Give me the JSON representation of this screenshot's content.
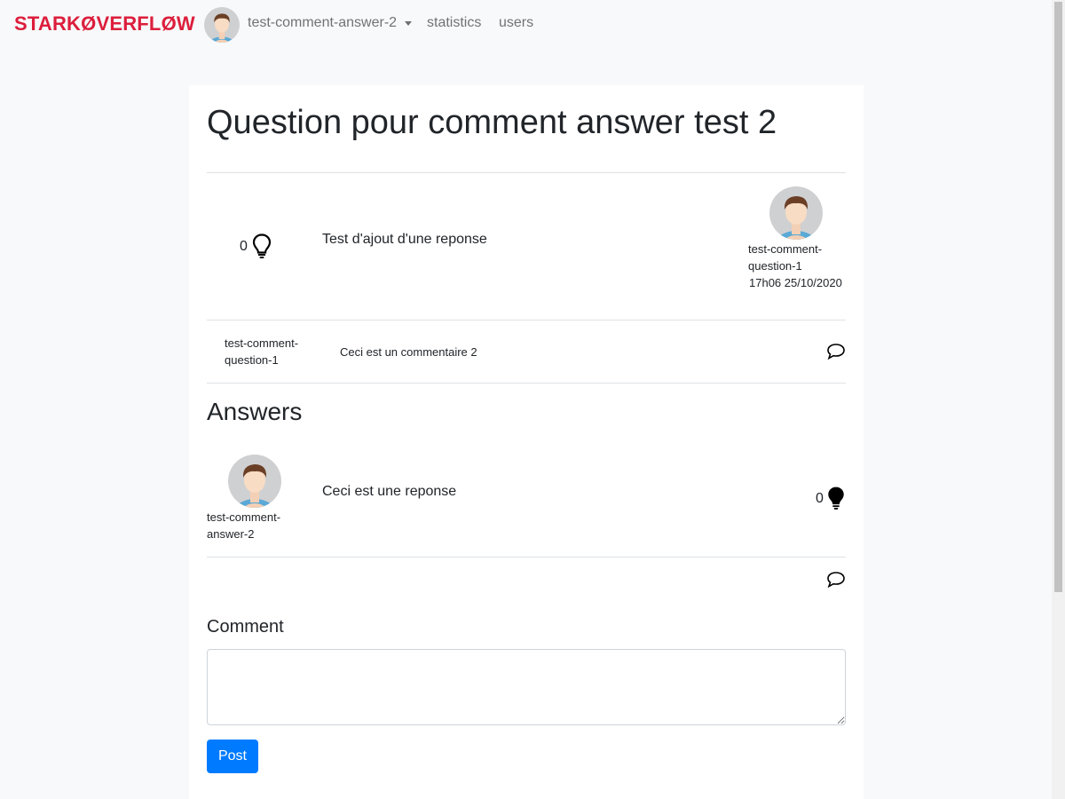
{
  "navbar": {
    "brand": "STARKØVERFLØW",
    "user_name": "test-comment-answer-2",
    "links": [
      "statistics",
      "users"
    ]
  },
  "question": {
    "title": "Question pour comment answer test 2",
    "score": "0",
    "body": "Test d'ajout d'une reponse",
    "author_line1": "test-comment-",
    "author_line2": "question-1",
    "date": "17h06 25/10/2020"
  },
  "question_comment": {
    "author_line1": "test-comment-",
    "author_line2": "question-1",
    "text": "Ceci est un commentaire 2"
  },
  "answers": {
    "heading": "Answers",
    "items": [
      {
        "author_line1": "test-comment-",
        "author_line2": "answer-2",
        "body": "Ceci est une reponse",
        "score": "0"
      }
    ]
  },
  "comment_form": {
    "label": "Comment",
    "placeholder": "",
    "post_label": "Post"
  },
  "colors": {
    "brand": "#dc1e3c",
    "primary": "#007bff",
    "background": "#f8f9fa"
  },
  "icons": {
    "question_vote": "lightbulb-outline-icon",
    "answer_vote": "lightbulb-filled-icon",
    "comment": "speech-bubble-icon"
  }
}
